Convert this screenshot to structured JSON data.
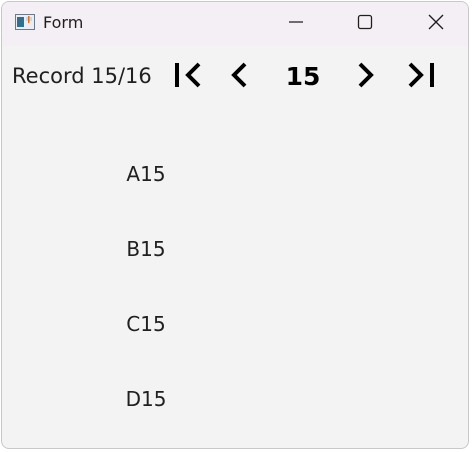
{
  "window": {
    "title": "Form",
    "icon": "form-app-icon",
    "controls": {
      "minimize": "minimize-icon",
      "maximize": "maximize-icon",
      "close": "close-icon"
    }
  },
  "navigator": {
    "record_label": "Record 15/16",
    "current_page": "15",
    "first_icon": "first-record-icon",
    "prev_icon": "previous-record-icon",
    "next_icon": "next-record-icon",
    "last_icon": "last-record-icon"
  },
  "fields": [
    {
      "value": "A15"
    },
    {
      "value": "B15"
    },
    {
      "value": "C15"
    },
    {
      "value": "D15"
    }
  ]
}
